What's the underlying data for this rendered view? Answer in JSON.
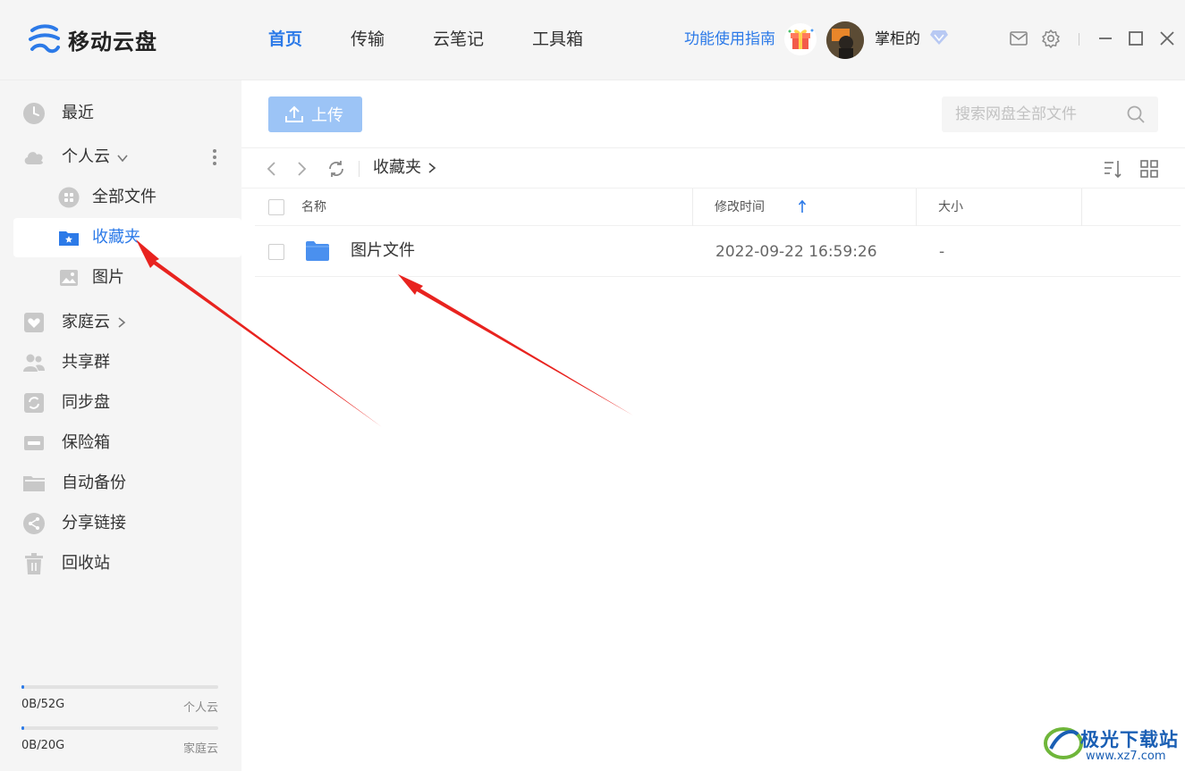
{
  "app": {
    "name": "移动云盘"
  },
  "nav": {
    "tabs": [
      "首页",
      "传输",
      "云笔记",
      "工具箱"
    ],
    "active_index": 0
  },
  "header": {
    "guide_label": "功能使用指南",
    "username": "掌柜的"
  },
  "sidebar": {
    "recent": "最近",
    "personal_cloud": "个人云",
    "all_files": "全部文件",
    "favorites": "收藏夹",
    "pictures": "图片",
    "family_cloud": "家庭云",
    "shared_group": "共享群",
    "sync_disk": "同步盘",
    "safe_box": "保险箱",
    "auto_backup": "自动备份",
    "share_links": "分享链接",
    "recycle_bin": "回收站"
  },
  "storage": [
    {
      "used": "0B/52G",
      "label": "个人云",
      "fraction": 0.01
    },
    {
      "used": "0B/20G",
      "label": "家庭云",
      "fraction": 0.01
    }
  ],
  "toolbar": {
    "upload_label": "上传",
    "search_placeholder": "搜索网盘全部文件"
  },
  "breadcrumb": {
    "current": "收藏夹"
  },
  "table": {
    "headers": {
      "name": "名称",
      "modified": "修改时间",
      "size": "大小"
    },
    "rows": [
      {
        "name": "图片文件",
        "modified": "2022-09-22 16:59:26",
        "size": "-"
      }
    ]
  },
  "watermark": {
    "title": "极光下载站",
    "url": "www.xz7.com"
  },
  "colors": {
    "accent": "#2c7ae8",
    "annotation": "#e8231f",
    "upload_button": "#9cc4f6"
  }
}
